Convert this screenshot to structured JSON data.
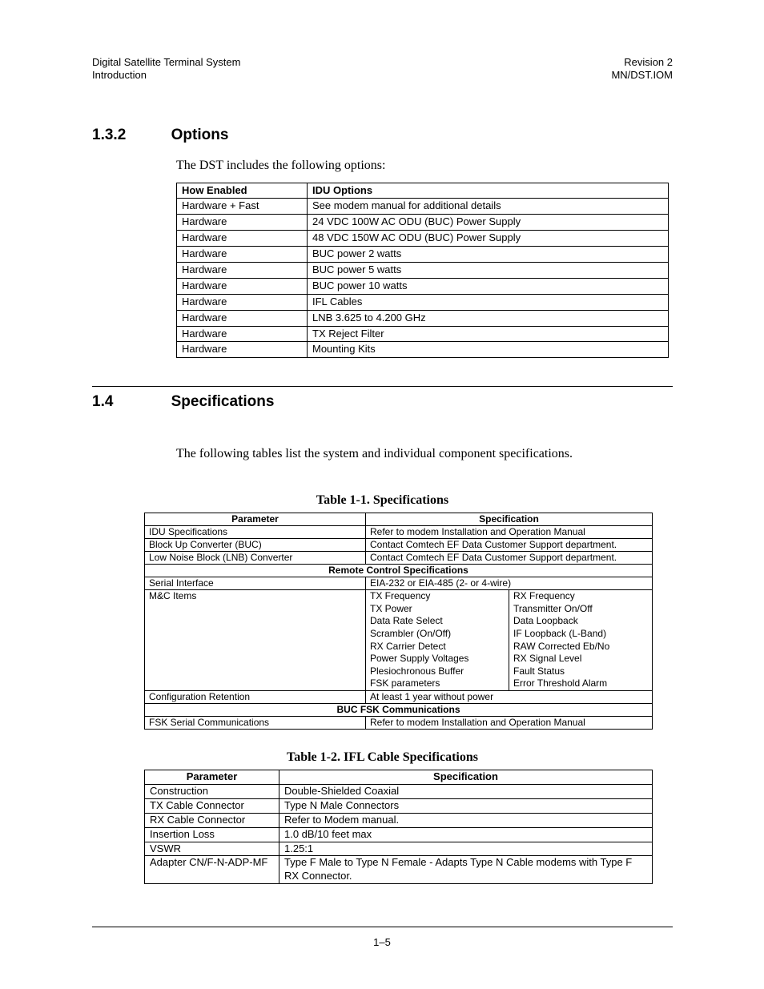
{
  "header": {
    "left1": "Digital Satellite Terminal System",
    "left2": "Introduction",
    "right1": "Revision 2",
    "right2": "MN/DST.IOM"
  },
  "sec132": {
    "num": "1.3.2",
    "title": "Options",
    "intro": "The DST includes the following options:"
  },
  "optsHdr": {
    "c1": "How Enabled",
    "c2": "IDU Options"
  },
  "opts": [
    {
      "a": "Hardware + Fast",
      "b": "See modem manual for additional details"
    },
    {
      "a": "Hardware",
      "b": "24 VDC 100W AC ODU (BUC) Power Supply"
    },
    {
      "a": "Hardware",
      "b": "48 VDC 150W AC ODU (BUC) Power Supply"
    },
    {
      "a": "Hardware",
      "b": "BUC power 2 watts"
    },
    {
      "a": "Hardware",
      "b": "BUC power 5 watts"
    },
    {
      "a": "Hardware",
      "b": "BUC power 10 watts"
    },
    {
      "a": "Hardware",
      "b": "IFL Cables"
    },
    {
      "a": "Hardware",
      "b": "LNB 3.625 to 4.200 GHz"
    },
    {
      "a": "Hardware",
      "b": "TX Reject Filter"
    },
    {
      "a": "Hardware",
      "b": "Mounting Kits"
    }
  ],
  "sec14": {
    "num": "1.4",
    "title": "Specifications",
    "intro": "The following tables list the system and individual component specifications."
  },
  "t11": {
    "caption": "Table 1-1.  Specifications",
    "hdr": {
      "p": "Parameter",
      "s": "Specification"
    },
    "r1": {
      "p": "IDU Specifications",
      "s": "Refer to modem Installation and Operation Manual"
    },
    "r2": {
      "p": "Block Up Converter (BUC)",
      "s": "Contact Comtech EF Data Customer Support department."
    },
    "r3": {
      "p": "Low Noise Block (LNB) Converter",
      "s": "Contact Comtech EF Data Customer Support department."
    },
    "sect1": "Remote Control Specifications",
    "r4": {
      "p": "Serial Interface",
      "s": "EIA-232 or EIA-485 (2- or 4-wire)"
    },
    "r5": {
      "p": "M&C Items",
      "left": [
        "TX Frequency",
        "TX Power",
        "Data Rate Select",
        "Scrambler (On/Off)",
        "RX Carrier Detect",
        "Power Supply Voltages",
        "Plesiochronous Buffer",
        "FSK parameters"
      ],
      "right": [
        "RX Frequency",
        "Transmitter On/Off",
        "Data Loopback",
        "IF Loopback (L-Band)",
        "RAW Corrected Eb/No",
        "RX Signal Level",
        "Fault Status",
        "Error Threshold Alarm"
      ]
    },
    "r6": {
      "p": "Configuration Retention",
      "s": "At least 1 year without power"
    },
    "sect2": "BUC FSK Communications",
    "r7": {
      "p": "FSK Serial Communications",
      "s": "Refer to modem Installation and Operation Manual"
    }
  },
  "t12": {
    "caption": "Table 1-2.   IFL Cable Specifications",
    "hdr": {
      "p": "Parameter",
      "s": "Specification"
    },
    "rows": [
      {
        "p": "Construction",
        "s": "Double-Shielded Coaxial"
      },
      {
        "p": "TX Cable Connector",
        "s": "Type N Male Connectors"
      },
      {
        "p": "RX Cable Connector",
        "s": "Refer to Modem manual."
      },
      {
        "p": "Insertion Loss",
        "s": "1.0 dB/10 feet max"
      },
      {
        "p": "VSWR",
        "s": "1.25:1"
      },
      {
        "p": "Adapter CN/F-N-ADP-MF",
        "s": "Type F Male to Type N Female - Adapts Type N Cable modems with Type F RX Connector."
      }
    ]
  },
  "pageNumber": "1–5"
}
